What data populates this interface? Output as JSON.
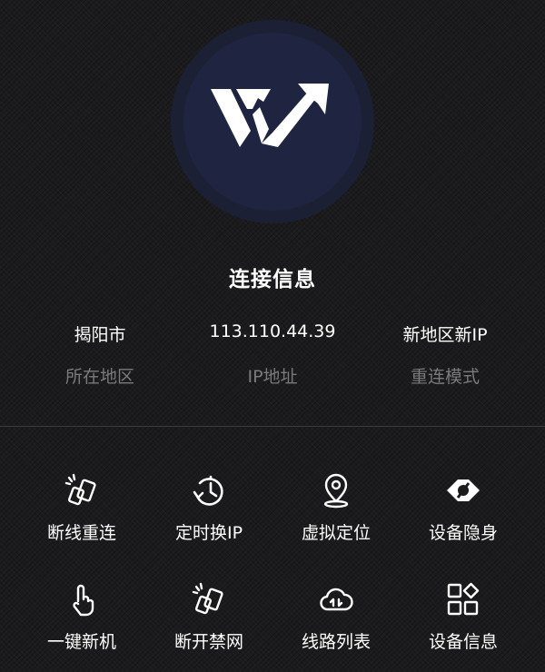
{
  "connection": {
    "title": "连接信息",
    "region_value": "揭阳市",
    "region_label": "所在地区",
    "ip_value": "113.110.44.39",
    "ip_label": "IP地址",
    "mode_value": "新地区新IP",
    "mode_label": "重连模式"
  },
  "tools": [
    {
      "label": "断线重连",
      "icon": "disconnect-reconnect-icon"
    },
    {
      "label": "定时换IP",
      "icon": "timer-icon"
    },
    {
      "label": "虚拟定位",
      "icon": "location-pin-icon"
    },
    {
      "label": "设备隐身",
      "icon": "hidden-eye-icon"
    },
    {
      "label": "一键新机",
      "icon": "tap-finger-icon"
    },
    {
      "label": "断开禁网",
      "icon": "disconnect-icon"
    },
    {
      "label": "线路列表",
      "icon": "cloud-transfer-icon"
    },
    {
      "label": "设备信息",
      "icon": "grid-icon"
    }
  ],
  "colors": {
    "background": "#1b1b1d",
    "logo_circle": "#1f2540",
    "muted_text": "#7a7a7c"
  }
}
